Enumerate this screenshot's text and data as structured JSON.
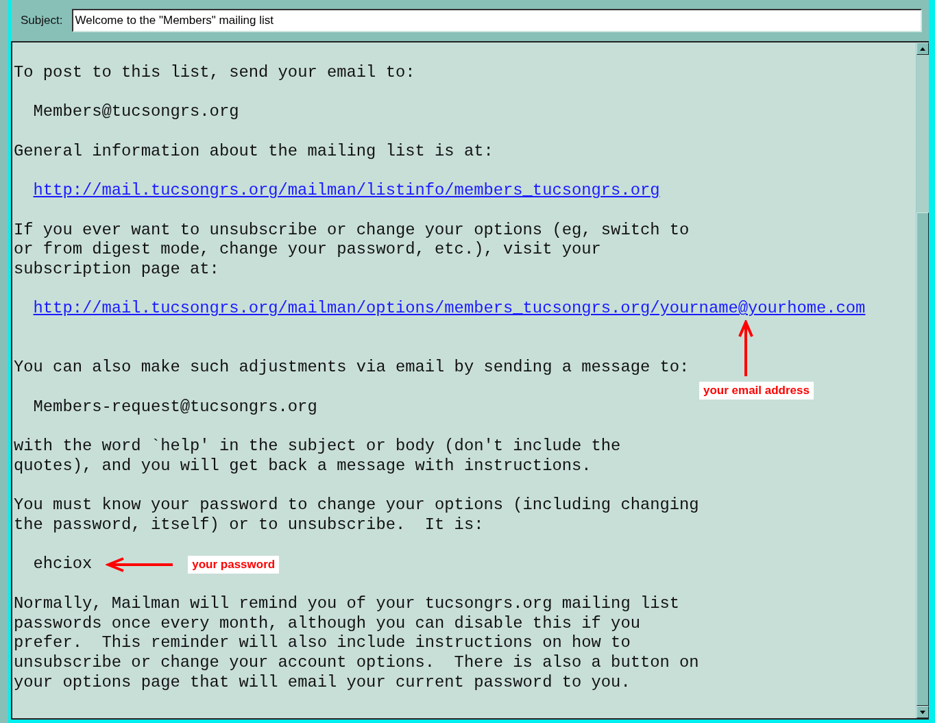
{
  "subject": {
    "label": "Subject:",
    "value": "Welcome to the \"Members\" mailing list"
  },
  "message": [
    {
      "kind": "text",
      "lines": [
        "To post to this list, send your email to:"
      ]
    },
    {
      "kind": "indent",
      "lines": [
        "Members@tucsongrs.org"
      ]
    },
    {
      "kind": "text",
      "lines": [
        "General information about the mailing list is at:"
      ]
    },
    {
      "kind": "link",
      "lines": [
        "http://mail.tucsongrs.org/mailman/listinfo/members_tucsongrs.org"
      ]
    },
    {
      "kind": "text",
      "lines": [
        "If you ever want to unsubscribe or change your options (eg, switch to",
        "or from digest mode, change your password, etc.), visit your",
        "subscription page at:"
      ]
    },
    {
      "kind": "link",
      "lines": [
        "http://mail.tucsongrs.org/mailman/options/members_tucsongrs.org/yourname@yourhome.com"
      ],
      "note": "your email address"
    },
    {
      "kind": "text",
      "lines": [
        "You can also make such adjustments via email by sending a message to:"
      ]
    },
    {
      "kind": "indent",
      "lines": [
        "Members-request@tucsongrs.org"
      ]
    },
    {
      "kind": "text",
      "lines": [
        "with the word `help' in the subject or body (don't include the",
        "quotes), and you will get back a message with instructions."
      ]
    },
    {
      "kind": "text",
      "lines": [
        "You must know your password to change your options (including changing",
        "the password, itself) or to unsubscribe.  It is:"
      ]
    },
    {
      "kind": "indent",
      "lines": [
        "ehciox"
      ],
      "note": "your password"
    },
    {
      "kind": "text",
      "lines": [
        "Normally, Mailman will remind you of your tucsongrs.org mailing list",
        "passwords once every month, although you can disable this if you",
        "prefer.  This reminder will also include instructions on how to",
        "unsubscribe or change your account options.  There is also a button on",
        "your options page that will email your current password to you."
      ]
    }
  ]
}
